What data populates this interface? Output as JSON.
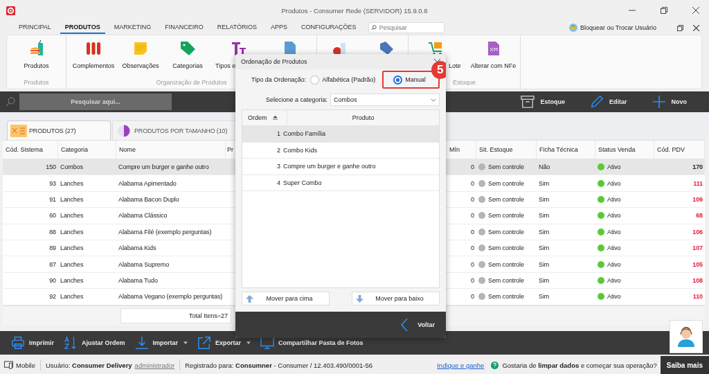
{
  "window": {
    "title": "Produtos - Consumer Rede (SERVIDOR) 15.9.0.8"
  },
  "menu_tabs": [
    {
      "label": "PRINCIPAL",
      "selected": false
    },
    {
      "label": "PRODUTOS",
      "selected": true
    },
    {
      "label": "MARKETING",
      "selected": false
    },
    {
      "label": "FINANCEIRO",
      "selected": false
    },
    {
      "label": "RELATÓRIOS",
      "selected": false
    },
    {
      "label": "APPS",
      "selected": false
    },
    {
      "label": "CONFIGURAÇÕES",
      "selected": false
    }
  ],
  "search": {
    "placeholder": "Pesquisar"
  },
  "user_button": "Bloquear ou Trocar Usuário",
  "ribbon_groups": [
    {
      "label": "Produtos",
      "items": [
        {
          "kind": "burger",
          "label": "Produtos"
        }
      ]
    },
    {
      "label": "Organização de Produtos",
      "items": [
        {
          "kind": "sausages",
          "label": "Complementos"
        },
        {
          "kind": "note",
          "label": "Observações"
        },
        {
          "kind": "tag",
          "label": "Categorias"
        },
        {
          "kind": "text",
          "label": "Tipos e"
        },
        {
          "kind": "doc"
        }
      ]
    },
    {
      "items": [
        {
          "kind": "grocery"
        },
        {
          "kind": "pricetag"
        }
      ]
    },
    {
      "label": "Estoque",
      "items": [
        {
          "kind": "cart",
          "label": "Lote"
        },
        {
          "kind": "xml",
          "label": "Alterar com NFe"
        }
      ]
    }
  ],
  "toolbar": {
    "search_placeholder": "Pesquisar aqui...",
    "actions": [
      {
        "kind": "box",
        "label": "Estoque"
      },
      {
        "kind": "pencil",
        "label": "Editar"
      },
      {
        "kind": "plus",
        "label": "Novo"
      }
    ]
  },
  "tabs": [
    {
      "kind": "menu",
      "label": "PRODUTOS (27)",
      "selected": true
    },
    {
      "kind": "half",
      "label": "PRODUTOS POR TAMANHO (10)",
      "selected": false
    }
  ],
  "table": {
    "columns": [
      "Cód. Sistema",
      "Categoria",
      "Nome",
      "Pr",
      "Mín",
      "Sit. Estoque",
      "Ficha Técnica",
      "Status Venda",
      "Cód. PDV"
    ],
    "rows": [
      {
        "code": "150",
        "category": "Combos",
        "name": "Compre um burger e ganhe outro",
        "min": "0",
        "stock": "Sem controle",
        "sheet": "Não",
        "status": "Ativo",
        "pdv": "170",
        "selected": true
      },
      {
        "code": "93",
        "category": "Lanches",
        "name": "Alabama Apimentado",
        "min": "0",
        "stock": "Sem controle",
        "sheet": "Sim",
        "status": "Ativo",
        "pdv": "111",
        "selected": false
      },
      {
        "code": "91",
        "category": "Lanches",
        "name": "Alabama Bacon Duplo",
        "min": "0",
        "stock": "Sem controle",
        "sheet": "Sim",
        "status": "Ativo",
        "pdv": "109",
        "selected": false
      },
      {
        "code": "60",
        "category": "Lanches",
        "name": "Alabama Clássico",
        "min": "0",
        "stock": "Sem controle",
        "sheet": "Sim",
        "status": "Ativo",
        "pdv": "68",
        "selected": false
      },
      {
        "code": "88",
        "category": "Lanches",
        "name": "Alabama Filé (exemplo perguntas)",
        "min": "0",
        "stock": "Sem controle",
        "sheet": "Sim",
        "status": "Ativo",
        "pdv": "106",
        "selected": false
      },
      {
        "code": "89",
        "category": "Lanches",
        "name": "Alabama Kids",
        "min": "0",
        "stock": "Sem controle",
        "sheet": "Sim",
        "status": "Ativo",
        "pdv": "107",
        "selected": false
      },
      {
        "code": "87",
        "category": "Lanches",
        "name": "Alabama Supremo",
        "min": "0",
        "stock": "Sem controle",
        "sheet": "Sim",
        "status": "Ativo",
        "pdv": "105",
        "selected": false
      },
      {
        "code": "90",
        "category": "Lanches",
        "name": "Alabama Tudo",
        "min": "0",
        "stock": "Sem controle",
        "sheet": "Sim",
        "status": "Ativo",
        "pdv": "108",
        "selected": false
      },
      {
        "code": "92",
        "category": "Lanches",
        "name": "Alabama Vegano (exemplo perguntas)",
        "min": "0",
        "stock": "Sem controle",
        "sheet": "Sim",
        "status": "Ativo",
        "pdv": "110",
        "selected": false
      }
    ],
    "total": "Total Itens=27"
  },
  "bottom_actions": [
    {
      "kind": "printer",
      "label": "Imprimir",
      "dropdown": false
    },
    {
      "kind": "sort",
      "label": "Ajustar Ordem",
      "dropdown": false
    },
    {
      "kind": "download",
      "label": "Importar",
      "dropdown": true
    },
    {
      "kind": "export",
      "label": "Exportar",
      "dropdown": true
    },
    {
      "kind": "monitor",
      "label": "Compartilhar Pasta de Fotos",
      "dropdown": false
    }
  ],
  "status_bar": {
    "mode": "Mobile",
    "user": "Usuário: **Consumer Delivery**",
    "role": "administrador",
    "registered": "Registrado para: **Consumner** - Consumer / 12.403.490/0001-56",
    "link": "Indique e ganhe",
    "question": "Gostaria de **limpar dados** e começar sua operação?",
    "button": "Saiba mais"
  },
  "dialog": {
    "title": "Ordenação de Produtos",
    "order_label": "Tipo da Ordenação:",
    "options": [
      {
        "label": "Alfabética (Padrão)",
        "selected": false,
        "highlighted": false
      },
      {
        "label": "Manual",
        "selected": true,
        "highlighted": true
      }
    ],
    "step": "5",
    "category_label": "Selecione a categoria:",
    "category": "Combos",
    "columns": [
      "Ordem",
      "Produto"
    ],
    "rows": [
      {
        "order": "1",
        "product": "Combo Família",
        "selected": true
      },
      {
        "order": "2",
        "product": "Combo Kids",
        "selected": false
      },
      {
        "order": "3",
        "product": "Compre um burger e ganhe outro",
        "selected": false
      },
      {
        "order": "4",
        "product": "Super Combo",
        "selected": false
      }
    ],
    "buttons": [
      {
        "kind": "up",
        "label": "Mover para cima"
      },
      {
        "kind": "down",
        "label": "Mover para baixo"
      }
    ],
    "back": "Voltar"
  }
}
